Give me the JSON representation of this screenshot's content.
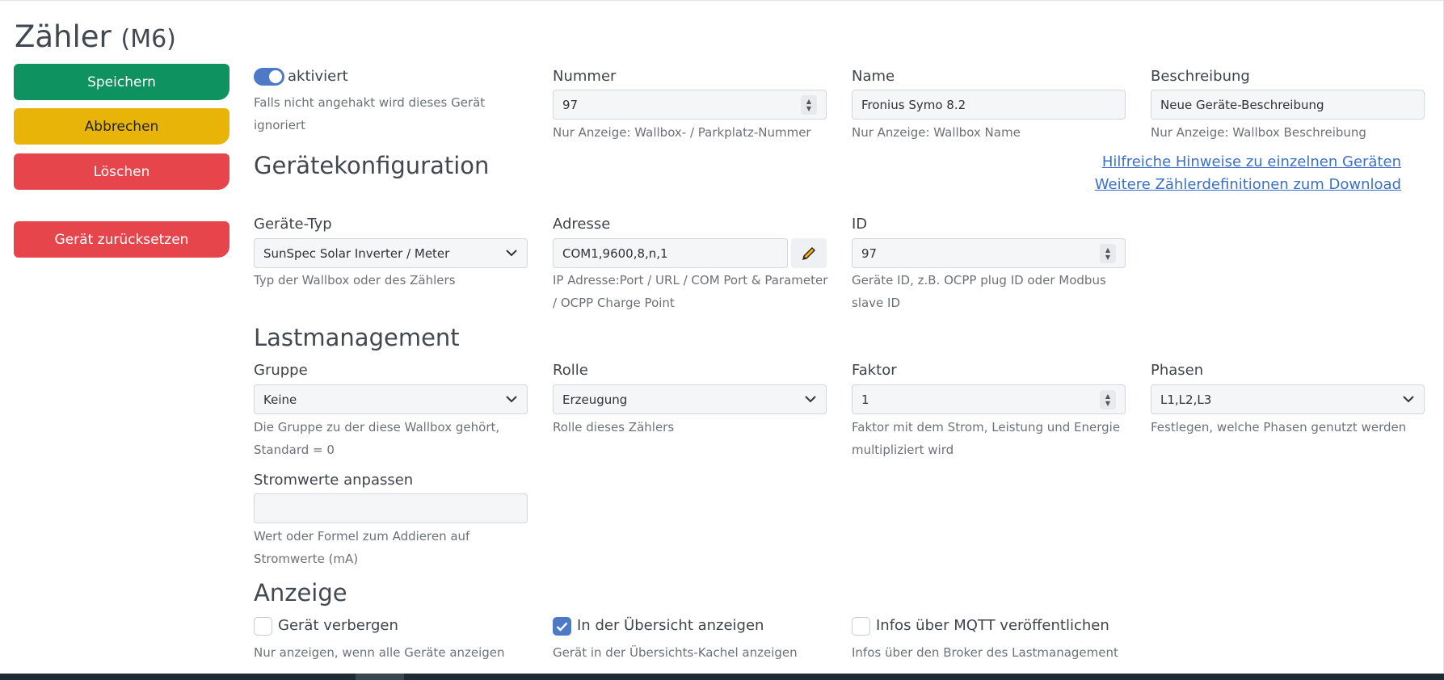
{
  "page": {
    "title": "Zähler",
    "title_suffix": "(M6)"
  },
  "sidebar": {
    "save": "Speichern",
    "cancel": "Abbrechen",
    "delete": "Löschen",
    "reset": "Gerät zurücksetzen"
  },
  "general": {
    "enabled_label": "aktiviert",
    "enabled_help": "Falls nicht angehakt wird dieses Gerät ignoriert",
    "enabled": true,
    "number_label": "Nummer",
    "number_value": "97",
    "number_help": "Nur Anzeige: Wallbox- / Parkplatz-Nummer",
    "name_label": "Name",
    "name_value": "Fronius Symo 8.2",
    "name_help": "Nur Anzeige: Wallbox Name",
    "description_label": "Beschreibung",
    "description_value": "Neue Geräte-Beschreibung",
    "description_help": "Nur Anzeige: Wallbox Beschreibung"
  },
  "device_config": {
    "heading": "Gerätekonfiguration",
    "link_hints": "Hilfreiche Hinweise zu einzelnen Geräten",
    "link_download": "Weitere Zählerdefinitionen zum Download",
    "type_label": "Geräte-Typ",
    "type_value": "SunSpec Solar Inverter / Meter",
    "type_help": "Typ der Wallbox oder des Zählers",
    "address_label": "Adresse",
    "address_value": "COM1,9600,8,n,1",
    "address_help": "IP Adresse:Port / URL / COM Port & Parameter / OCPP Charge Point",
    "id_label": "ID",
    "id_value": "97",
    "id_help": "Geräte ID, z.B. OCPP plug ID oder Modbus slave ID"
  },
  "load_mgmt": {
    "heading": "Lastmanagement",
    "group_label": "Gruppe",
    "group_value": "Keine",
    "group_help": "Die Gruppe zu der diese Wallbox gehört, Standard = 0",
    "role_label": "Rolle",
    "role_value": "Erzeugung",
    "role_help": "Rolle dieses Zählers",
    "factor_label": "Faktor",
    "factor_value": "1",
    "factor_help": "Faktor mit dem Strom, Leistung und Energie multipliziert wird",
    "phases_label": "Phasen",
    "phases_value": "L1,L2,L3",
    "phases_help": "Festlegen, welche Phasen genutzt werden",
    "current_adjust_label": "Stromwerte anpassen",
    "current_adjust_value": "",
    "current_adjust_help": "Wert oder Formel zum Addieren auf Stromwerte (mA)"
  },
  "display": {
    "heading": "Anzeige",
    "hide_label": "Gerät verbergen",
    "hide_checked": false,
    "hide_help": "Nur anzeigen, wenn alle Geräte anzeigen",
    "overview_label": "In der Übersicht anzeigen",
    "overview_checked": true,
    "overview_help": "Gerät in der Übersichts-Kachel anzeigen",
    "mqtt_label": "Infos über MQTT veröffentlichen",
    "mqtt_checked": false,
    "mqtt_help": "Infos über den Broker des Lastmanagement"
  },
  "colors": {
    "save": "#0e9360",
    "cancel": "#e8b408",
    "delete": "#e6454c",
    "accent": "#4d79c6"
  }
}
